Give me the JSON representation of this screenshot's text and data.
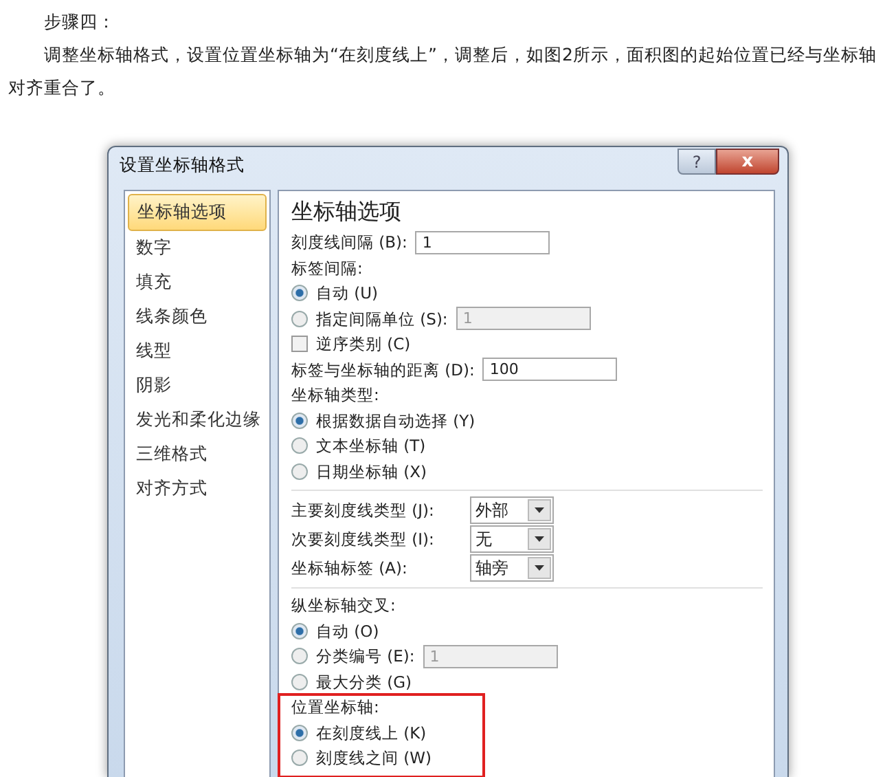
{
  "article": {
    "heading": "步骤四：",
    "paragraph": "调整坐标轴格式，设置位置坐标轴为“在刻度线上”，调整后，如图2所示，面积图的起始位置已经与坐标轴对齐重合了。"
  },
  "dialog": {
    "title": "设置坐标轴格式",
    "help_button": "?",
    "close_button": "x",
    "sidebar": {
      "items": [
        {
          "label": "坐标轴选项",
          "selected": true
        },
        {
          "label": "数字",
          "selected": false
        },
        {
          "label": "填充",
          "selected": false
        },
        {
          "label": "线条颜色",
          "selected": false
        },
        {
          "label": "线型",
          "selected": false
        },
        {
          "label": "阴影",
          "selected": false
        },
        {
          "label": "发光和柔化边缘",
          "selected": false
        },
        {
          "label": "三维格式",
          "selected": false
        },
        {
          "label": "对齐方式",
          "selected": false
        }
      ]
    },
    "panel": {
      "heading": "坐标轴选项",
      "sections": [
        {
          "divider_above": false,
          "highlighted": false,
          "rows": [
            {
              "kind": "field",
              "label": "刻度线间隔 (B):",
              "value": "1",
              "disabled": false
            },
            {
              "kind": "label",
              "label": "标签间隔:"
            },
            {
              "kind": "radio",
              "label": "自动 (U)",
              "selected": true
            },
            {
              "kind": "radio",
              "label": "指定间隔单位 (S):",
              "selected": false,
              "value": "1",
              "disabled": true
            },
            {
              "kind": "checkbox",
              "label": "逆序类别 (C)",
              "checked": false
            },
            {
              "kind": "field",
              "label": "标签与坐标轴的距离 (D):",
              "value": "100",
              "disabled": false
            },
            {
              "kind": "label",
              "label": "坐标轴类型:"
            },
            {
              "kind": "radio",
              "label": "根据数据自动选择 (Y)",
              "selected": true
            },
            {
              "kind": "radio",
              "label": "文本坐标轴 (T)",
              "selected": false
            },
            {
              "kind": "radio",
              "label": "日期坐标轴 (X)",
              "selected": false
            }
          ]
        },
        {
          "divider_above": true,
          "highlighted": false,
          "rows": [
            {
              "kind": "select",
              "label": "主要刻度线类型 (J):",
              "value": "外部"
            },
            {
              "kind": "select",
              "label": "次要刻度线类型 (I):",
              "value": "无"
            },
            {
              "kind": "select",
              "label": "坐标轴标签 (A):",
              "value": "轴旁"
            }
          ]
        },
        {
          "divider_above": true,
          "highlighted": false,
          "rows": [
            {
              "kind": "label",
              "label": "纵坐标轴交叉:"
            },
            {
              "kind": "radio",
              "label": "自动 (O)",
              "selected": true
            },
            {
              "kind": "radio",
              "label": "分类编号 (E):",
              "selected": false,
              "value": "1",
              "disabled": true
            },
            {
              "kind": "radio",
              "label": "最大分类 (G)",
              "selected": false
            }
          ]
        },
        {
          "divider_above": false,
          "highlighted": true,
          "rows": [
            {
              "kind": "label",
              "label": "位置坐标轴:"
            },
            {
              "kind": "radio",
              "label": "在刻度线上 (K)",
              "selected": true
            },
            {
              "kind": "radio",
              "label": "刻度线之间 (W)",
              "selected": false
            }
          ]
        }
      ]
    }
  }
}
